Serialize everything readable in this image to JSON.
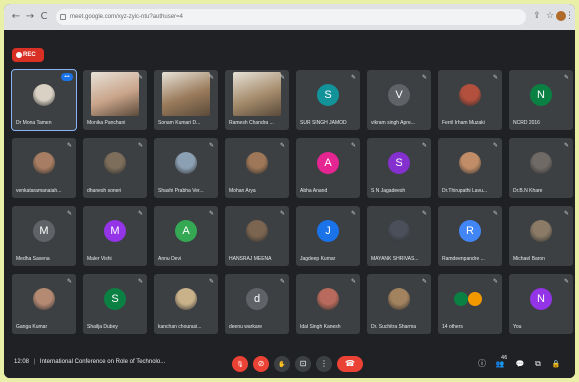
{
  "browser": {
    "url": "meet.google.com/xyz-zyic-ntu?authuser=4",
    "back_icon": "←",
    "forward_icon": "→",
    "reload_icon": "C",
    "share_icon": "⇪",
    "star_icon": "☆",
    "profile_initial": "",
    "menu_icon": "⋮"
  },
  "rec": {
    "label": "REC"
  },
  "participants": [
    {
      "name": "Dr Mona Tamen",
      "kind": "photo",
      "color": "#d9d2c4",
      "letter": "",
      "pinned": true
    },
    {
      "name": "Monika Panchani",
      "kind": "video",
      "color": "#c9a48a",
      "letter": ""
    },
    {
      "name": "Sonam Kumari D...",
      "kind": "video",
      "color": "#9a7b5b",
      "letter": ""
    },
    {
      "name": "Ramesh Chandra ...",
      "kind": "video",
      "color": "#a58c6c",
      "letter": ""
    },
    {
      "name": "SUR SINGH JAMOD",
      "kind": "letter",
      "color": "#12939a",
      "letter": "S"
    },
    {
      "name": "vikram singh Apre...",
      "kind": "letter",
      "color": "#5f6368",
      "letter": "V"
    },
    {
      "name": "Ferril Irham Muzaki",
      "kind": "photo",
      "color": "#b3503d",
      "letter": ""
    },
    {
      "name": "NCRD 2016",
      "kind": "letter",
      "color": "#0b8043",
      "letter": "N"
    },
    {
      "name": "venkataramanaiah...",
      "kind": "photo",
      "color": "#a77d63",
      "letter": ""
    },
    {
      "name": "dhanesh soneri",
      "kind": "photo",
      "color": "#7d6e5b",
      "letter": ""
    },
    {
      "name": "Shashi Prabha Ver...",
      "kind": "photo",
      "color": "#8ca0b3",
      "letter": ""
    },
    {
      "name": "Mohan Arya",
      "kind": "photo",
      "color": "#9d7757",
      "letter": ""
    },
    {
      "name": "Abha Anand",
      "kind": "letter",
      "color": "#e52592",
      "letter": "A"
    },
    {
      "name": "S N Jagadeesh",
      "kind": "letter",
      "color": "#8430ce",
      "letter": "S"
    },
    {
      "name": "Dr.Thirupathi Lavu...",
      "kind": "photo",
      "color": "#c08d68",
      "letter": ""
    },
    {
      "name": "Dr.B.N Khare",
      "kind": "photo",
      "color": "#6f6a66",
      "letter": ""
    },
    {
      "name": "Medha Saxena",
      "kind": "letter",
      "color": "#5f6368",
      "letter": "M"
    },
    {
      "name": "Maler Vishi",
      "kind": "letter",
      "color": "#9334e6",
      "letter": "M"
    },
    {
      "name": "Annu Devi",
      "kind": "letter",
      "color": "#34a853",
      "letter": "A"
    },
    {
      "name": "HANSRAJ MEENA",
      "kind": "photo",
      "color": "#7b6550",
      "letter": ""
    },
    {
      "name": "Jagdeep Kumar",
      "kind": "letter",
      "color": "#1a73e8",
      "letter": "J"
    },
    {
      "name": "MAYANK SHRIVAS...",
      "kind": "photo",
      "color": "#4a4f5a",
      "letter": ""
    },
    {
      "name": "Ramdeenpandre ...",
      "kind": "letter",
      "color": "#4285f4",
      "letter": "R"
    },
    {
      "name": "Michael Baron",
      "kind": "photo",
      "color": "#8a7a66",
      "letter": ""
    },
    {
      "name": "Ganga Kumar",
      "kind": "photo",
      "color": "#b58a73",
      "letter": ""
    },
    {
      "name": "Shailja Dubey",
      "kind": "letter",
      "color": "#0b8043",
      "letter": "S"
    },
    {
      "name": "kanchan chourasi...",
      "kind": "photo",
      "color": "#c9b28a",
      "letter": ""
    },
    {
      "name": "deenu warkare",
      "kind": "letter",
      "color": "#5f6368",
      "letter": "d"
    },
    {
      "name": "Idal Singh Kanesh",
      "kind": "photo",
      "color": "#b86b5c",
      "letter": ""
    },
    {
      "name": "Dr. Suchitra Sharma",
      "kind": "photo",
      "color": "#a3835f",
      "letter": ""
    },
    {
      "name": "14 others",
      "kind": "others",
      "color": "#34a853",
      "letter": ""
    },
    {
      "name": "You",
      "kind": "letter",
      "color": "#9334e6",
      "letter": "N"
    }
  ],
  "bottom": {
    "time": "12:08",
    "separator": "|",
    "meeting_title": "International Conference on Role of Technolo...",
    "mic_icon": "🎙",
    "camera_icon": "⊘",
    "hand_icon": "✋",
    "present_icon": "⊡",
    "more_icon": "⋮",
    "hangup_icon": "☎",
    "info_icon": "ⓘ",
    "people_icon": "👥",
    "people_count": "46",
    "chat_icon": "💬",
    "activities_icon": "⧉",
    "lock_icon": "🔒"
  }
}
